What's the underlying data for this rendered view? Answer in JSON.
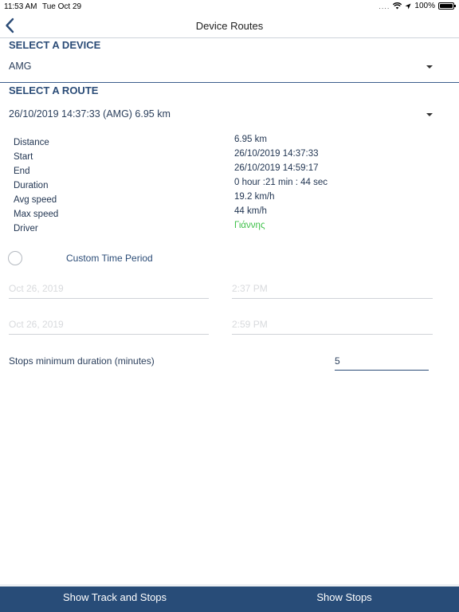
{
  "status": {
    "time": "11:53 AM",
    "date": "Tue Oct 29",
    "dots": "....",
    "battery": "100%"
  },
  "nav": {
    "title": "Device Routes"
  },
  "device": {
    "heading": "SELECT A DEVICE",
    "value": "AMG"
  },
  "route": {
    "heading": "SELECT A ROUTE",
    "value": "26/10/2019 14:37:33 (AMG) 6.95 km"
  },
  "details": [
    {
      "label": "Distance",
      "value": "6.95 km"
    },
    {
      "label": "Start",
      "value": "26/10/2019 14:37:33"
    },
    {
      "label": "End",
      "value": "26/10/2019 14:59:17"
    },
    {
      "label": "Duration",
      "value": "0 hour :21 min : 44 sec"
    },
    {
      "label": "Avg speed",
      "value": "19.2 km/h"
    },
    {
      "label": "Max speed",
      "value": "44 km/h"
    },
    {
      "label": "Driver",
      "value": "Γιάννης"
    }
  ],
  "custom_period": {
    "label": "Custom Time Period"
  },
  "period": {
    "from_date": "Oct 26, 2019",
    "from_time": "2:37 PM",
    "to_date": "Oct 26, 2019",
    "to_time": "2:59 PM"
  },
  "stops": {
    "label": "Stops minimum duration (minutes)",
    "value": "5"
  },
  "bottom": {
    "track_label": "Show Track and Stops",
    "stops_label": "Show Stops"
  },
  "colors": {
    "accent": "#284c78",
    "driver": "#3fc14a",
    "divider": "#3b5d8c"
  }
}
